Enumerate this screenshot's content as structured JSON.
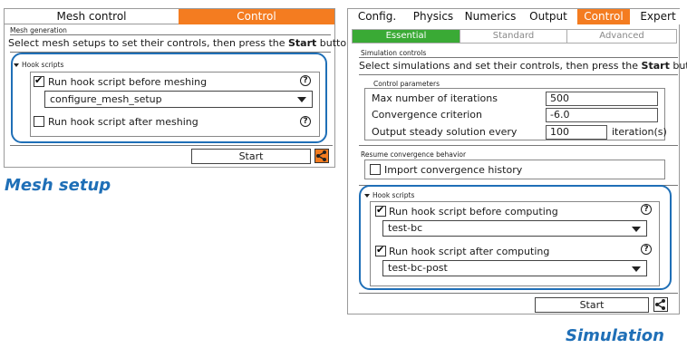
{
  "mesh": {
    "tab_mesh_control": "Mesh control",
    "tab_control": "Control",
    "section_label": "Mesh generation",
    "instruction_prefix": "Select mesh setups to set their controls, then press the ",
    "instruction_bold": "Start",
    "instruction_suffix": " button.",
    "hook_header": "Hook scripts",
    "before_label": "Run hook script before meshing",
    "before_checked": true,
    "before_value": "configure_mesh_setup",
    "after_label": "Run hook script after meshing",
    "after_checked": false,
    "start_label": "Start",
    "caption": "Mesh setup"
  },
  "sim": {
    "tabs": [
      "Config.",
      "Physics",
      "Numerics",
      "Output",
      "Control",
      "Expert"
    ],
    "active_tab": "Control",
    "subtabs": [
      "Essential",
      "Standard",
      "Advanced"
    ],
    "active_subtab": "Essential",
    "section_label": "Simulation controls",
    "instruction_prefix": "Select simulations and set their controls, then press the ",
    "instruction_bold": "Start",
    "instruction_suffix": " button.",
    "control_params_label": "Control parameters",
    "max_iter_label": "Max number of iterations",
    "max_iter_value": "500",
    "conv_label": "Convergence criterion",
    "conv_value": "-6.0",
    "output_label": "Output steady solution every",
    "output_value": "100",
    "output_unit": "iteration(s)",
    "resume_label": "Resume convergence behavior",
    "import_label": "Import convergence history",
    "hook_header": "Hook scripts",
    "before_label": "Run hook script before computing",
    "before_value": "test-bc",
    "after_label": "Run hook script after computing",
    "after_value": "test-bc-post",
    "start_label": "Start",
    "caption": "Simulation"
  },
  "colors": {
    "orange": "#f47c20",
    "green": "#3aaa35",
    "blue": "#1f6fb7"
  }
}
